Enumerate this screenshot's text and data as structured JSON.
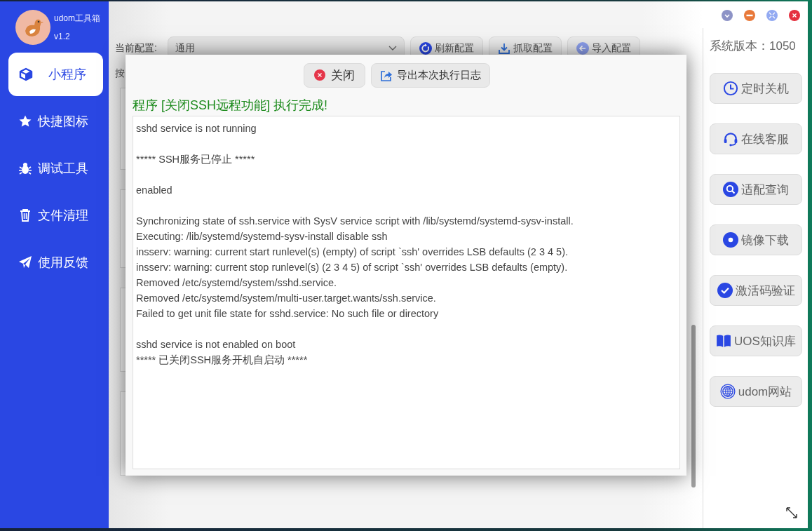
{
  "app": {
    "name": "udom工具箱",
    "version": "v1.2"
  },
  "nav": [
    {
      "label": "小程序",
      "selected": true
    },
    {
      "label": "快捷图标",
      "selected": false
    },
    {
      "label": "调试工具",
      "selected": false
    },
    {
      "label": "文件清理",
      "selected": false
    },
    {
      "label": "使用反馈",
      "selected": false
    }
  ],
  "config": {
    "label": "当前配置:",
    "value": "通用",
    "buttons": [
      "刷新配置",
      "抓取配置",
      "导入配置"
    ],
    "section_label": "按"
  },
  "system_version": "系统版本：1050",
  "tools": [
    "定时关机",
    "在线客服",
    "适配查询",
    "镜像下载",
    "激活码验证",
    "UOS知识库",
    "udom网站"
  ],
  "dialog": {
    "buttons": [
      "关闭",
      "导出本次执行日志"
    ],
    "title": "程序 [关闭SSH远程功能] 执行完成!",
    "log": [
      [
        "sshd service is not running"
      ],
      [
        "***** SSH服务已停止 *****"
      ],
      [
        "enabled"
      ],
      [
        "Synchronizing state of ssh.service with SysV service script with /lib/systemd/systemd-sysv-install.",
        "Executing: /lib/systemd/systemd-sysv-install disable ssh",
        "insserv: warning: current start runlevel(s) (empty) of script `ssh' overrides LSB defaults (2 3 4 5).",
        "insserv: warning: current stop runlevel(s) (2 3 4 5) of script `ssh' overrides LSB defaults (empty).",
        "Removed /etc/systemd/system/sshd.service.",
        "Removed /etc/systemd/system/multi-user.target.wants/ssh.service.",
        "Failed to get unit file state for sshd.service: No such file or directory"
      ],
      [
        "sshd service is not enabled on boot",
        "***** 已关闭SSH服务开机自启动 *****"
      ]
    ]
  }
}
